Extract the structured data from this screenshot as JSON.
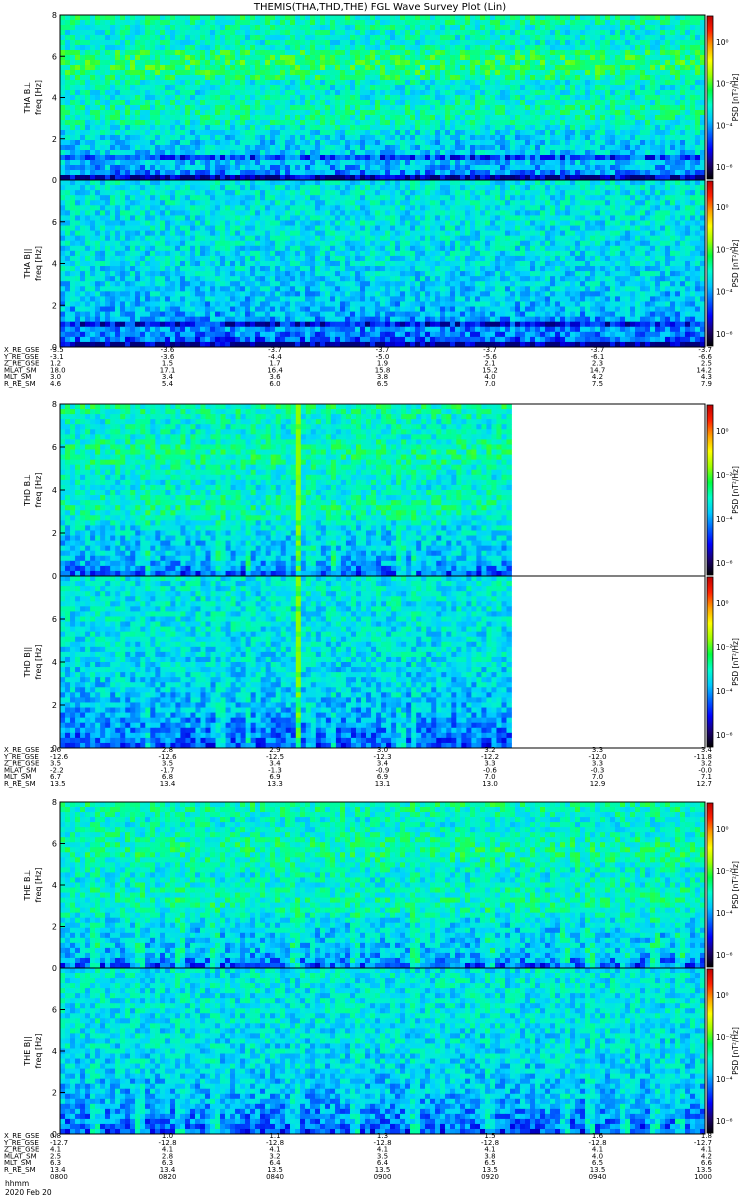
{
  "title": "THEMIS(THA,THD,THE) FGL Wave Survey Plot (Lin)",
  "colorbar": {
    "label": "PSD [nT²/Hz]",
    "ticks_top": [
      "10⁰",
      "10⁻²",
      "10⁻⁴",
      "10⁻⁶"
    ],
    "colors": [
      "#000000",
      "#1a0070",
      "#0000ff",
      "#0060ff",
      "#00c8ff",
      "#00ffcc",
      "#00ff40",
      "#a0ff00",
      "#ffff00",
      "#ffa000",
      "#ff2000",
      "#c00000"
    ]
  },
  "footer": {
    "line1": "hhmm",
    "line2": "2020 Feb 20"
  },
  "chart_data": [
    {
      "type": "heatmap",
      "probe": "THA",
      "panels": [
        {
          "ylabel": "THA B⊥",
          "yunit": "freq [Hz]",
          "ylim": [
            0,
            8
          ],
          "yticks": [
            "0",
            "2",
            "4",
            "6",
            "8"
          ],
          "cbar_ticks": [
            "10⁰",
            "10⁻²",
            "10⁻⁴",
            "10⁻⁶"
          ],
          "data_fraction": 1.0
        },
        {
          "ylabel": "THA B||",
          "yunit": "freq [Hz]",
          "ylim": [
            0,
            8
          ],
          "yticks": [
            "0",
            "2",
            "4",
            "6"
          ],
          "cbar_ticks": [
            "10⁰",
            "10⁻²",
            "10⁻⁴",
            "10⁻⁶"
          ],
          "data_fraction": 1.0
        }
      ],
      "ephemeris": {
        "labels": [
          "X_RE_GSE",
          "Y_RE_GSE",
          "Z_RE_GSE",
          "MLAT_SM",
          "MLT_SM",
          "R_RE_SM"
        ],
        "columns": [
          [
            "-3.5",
            "-3.1",
            "1.2",
            "18.0",
            "3.0",
            "4.6"
          ],
          [
            "-3.6",
            "-3.6",
            "1.5",
            "17.1",
            "3.4",
            "5.4"
          ],
          [
            "-3.7",
            "-4.4",
            "1.7",
            "16.4",
            "3.6",
            "6.0"
          ],
          [
            "-3.7",
            "-5.0",
            "1.9",
            "15.8",
            "3.8",
            "6.5"
          ],
          [
            "-3.7",
            "-5.6",
            "2.1",
            "15.2",
            "4.0",
            "7.0"
          ],
          [
            "-3.7",
            "-6.1",
            "2.3",
            "14.7",
            "4.2",
            "7.5"
          ],
          [
            "-3.7",
            "-6.6",
            "2.5",
            "14.2",
            "4.3",
            "7.9"
          ]
        ]
      }
    },
    {
      "type": "heatmap",
      "probe": "THD",
      "panels": [
        {
          "ylabel": "THD B⊥",
          "yunit": "freq [Hz]",
          "ylim": [
            0,
            8
          ],
          "yticks": [
            "0",
            "2",
            "4",
            "6",
            "8"
          ],
          "cbar_ticks": [
            "10⁰",
            "10⁻²",
            "10⁻⁴",
            "10⁻⁶"
          ],
          "data_fraction": 0.7
        },
        {
          "ylabel": "THD B||",
          "yunit": "freq [Hz]",
          "ylim": [
            0,
            8
          ],
          "yticks": [
            "0",
            "2",
            "4",
            "6"
          ],
          "cbar_ticks": [
            "10⁰",
            "10⁻²",
            "10⁻⁴",
            "10⁻⁶"
          ],
          "data_fraction": 0.7
        }
      ],
      "ephemeris": {
        "labels": [
          "X_RE_GSE",
          "Y_RE_GSE",
          "Z_RE_GSE",
          "MLAT_SM",
          "MLT_SM",
          "R_RE_SM"
        ],
        "columns": [
          [
            "2.6",
            "-12.6",
            "3.5",
            "-2.2",
            "6.7",
            "13.5"
          ],
          [
            "2.8",
            "-12.6",
            "3.5",
            "-1.7",
            "6.8",
            "13.4"
          ],
          [
            "2.9",
            "-12.5",
            "3.4",
            "-1.3",
            "6.9",
            "13.3"
          ],
          [
            "3.0",
            "-12.3",
            "3.4",
            "-0.9",
            "6.9",
            "13.1"
          ],
          [
            "3.2",
            "-12.2",
            "3.3",
            "-0.6",
            "7.0",
            "13.0"
          ],
          [
            "3.3",
            "-12.0",
            "3.3",
            "-0.3",
            "7.0",
            "12.9"
          ],
          [
            "3.4",
            "-11.8",
            "3.2",
            "-0.0",
            "7.1",
            "12.7"
          ]
        ]
      }
    },
    {
      "type": "heatmap",
      "probe": "THE",
      "panels": [
        {
          "ylabel": "THE B⊥",
          "yunit": "freq [Hz]",
          "ylim": [
            0,
            8
          ],
          "yticks": [
            "0",
            "2",
            "4",
            "6",
            "8"
          ],
          "cbar_ticks": [
            "10⁰",
            "10⁻²",
            "10⁻⁴",
            "10⁻⁶"
          ],
          "data_fraction": 1.0
        },
        {
          "ylabel": "THE B||",
          "yunit": "freq [Hz]",
          "ylim": [
            0,
            8
          ],
          "yticks": [
            "0",
            "2",
            "4",
            "6"
          ],
          "cbar_ticks": [
            "10⁰",
            "10⁻²",
            "10⁻⁴",
            "10⁻⁶"
          ],
          "data_fraction": 1.0
        }
      ],
      "ephemeris": {
        "labels": [
          "X_RE_GSE",
          "Y_RE_GSE",
          "Z_RE_GSE",
          "MLAT_SM",
          "MLT_SM",
          "R_RE_SM"
        ],
        "columns": [
          [
            "0.8",
            "-12.7",
            "4.1",
            "2.5",
            "6.3",
            "13.4",
            "0800"
          ],
          [
            "1.0",
            "-12.8",
            "4.1",
            "2.8",
            "6.3",
            "13.4",
            "0820"
          ],
          [
            "1.1",
            "-12.8",
            "4.1",
            "3.2",
            "6.4",
            "13.5",
            "0840"
          ],
          [
            "1.3",
            "-12.8",
            "4.1",
            "3.5",
            "6.4",
            "13.5",
            "0900"
          ],
          [
            "1.5",
            "-12.8",
            "4.1",
            "3.8",
            "6.5",
            "13.5",
            "0920"
          ],
          [
            "1.6",
            "-12.8",
            "4.1",
            "4.0",
            "6.5",
            "13.5",
            "0940"
          ],
          [
            "1.8",
            "-12.7",
            "4.1",
            "4.2",
            "6.6",
            "13.5",
            "1000"
          ]
        ]
      }
    }
  ]
}
